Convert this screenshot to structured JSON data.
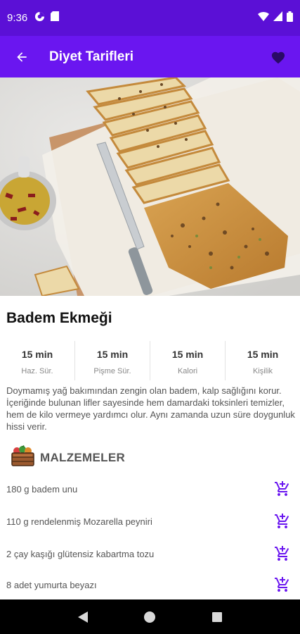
{
  "status_bar": {
    "time": "9:36"
  },
  "app_bar": {
    "title": "Diyet Tarifleri"
  },
  "recipe": {
    "title": "Badem Ekmeği",
    "stats": [
      {
        "value": "15 min",
        "label": "Haz. Sür."
      },
      {
        "value": "15 min",
        "label": "Pişme Sür."
      },
      {
        "value": "15 min",
        "label": "Kalori"
      },
      {
        "value": "15 min",
        "label": "Kişilik"
      }
    ],
    "description": "Doymamış yağ bakımından zengin olan badem, kalp sağlığını korur. İçeriğinde bulunan lifler sayesinde hem damardaki toksinleri temizler, hem de kilo vermeye yardımcı olur. Aynı zamanda uzun süre doygunluk hissi verir."
  },
  "ingredients_section": {
    "title": "MALZEMELER",
    "items": [
      "180 g badem unu",
      "110 g rendelenmiş Mozarella peyniri",
      "2 çay kaşığı glütensiz kabartma tozu",
      "8 adet yumurta beyazı"
    ]
  },
  "colors": {
    "status_bar": "#5b10d6",
    "app_bar": "#6a16f0",
    "accent": "#6a16f0"
  }
}
